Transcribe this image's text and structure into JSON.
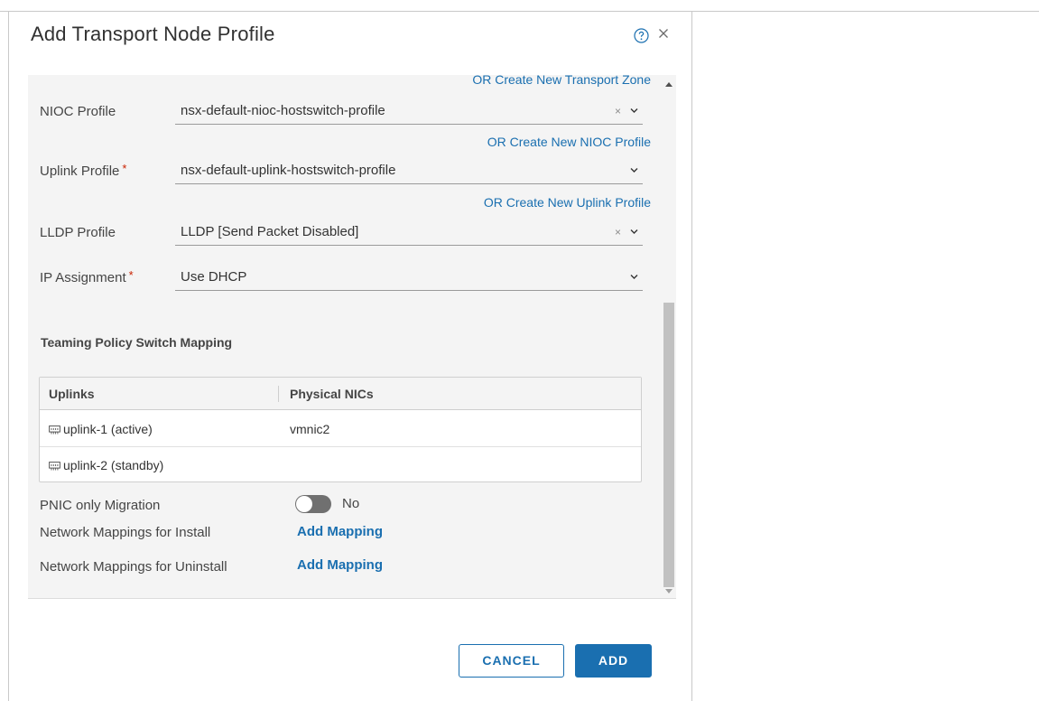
{
  "dialog": {
    "title": "Add Transport Node Profile"
  },
  "links": {
    "create_transport_zone": "OR Create New Transport Zone",
    "create_nioc_profile": "OR Create New NIOC Profile",
    "create_uplink_profile": "OR Create New Uplink Profile"
  },
  "fields": {
    "nioc": {
      "label": "NIOC Profile",
      "value": "nsx-default-nioc-hostswitch-profile"
    },
    "uplink": {
      "label": "Uplink Profile",
      "required_mark": "*",
      "value": "nsx-default-uplink-hostswitch-profile"
    },
    "lldp": {
      "label": "LLDP Profile",
      "value": "LLDP [Send Packet Disabled]"
    },
    "ip": {
      "label": "IP Assignment",
      "required_mark": "*",
      "value": "Use DHCP"
    }
  },
  "clear_glyph": "×",
  "teaming": {
    "title": "Teaming Policy Switch Mapping",
    "columns": [
      "Uplinks",
      "Physical NICs"
    ],
    "rows": [
      {
        "uplink": "uplink-1 (active)",
        "nic": "vmnic2"
      },
      {
        "uplink": "uplink-2 (standby)",
        "nic": ""
      }
    ]
  },
  "pnic": {
    "label": "PNIC only Migration",
    "toggle_text": "No",
    "toggle_on": false
  },
  "mappings": {
    "install_label": "Network Mappings for Install",
    "uninstall_label": "Network Mappings for Uninstall",
    "add_label": "Add Mapping"
  },
  "buttons": {
    "cancel": "CANCEL",
    "add": "ADD"
  },
  "colors": {
    "accent": "#1a6fb0",
    "required": "#c92100",
    "panel": "#f4f4f4"
  },
  "icons": [
    "help-icon",
    "close-icon",
    "chevron-down-icon",
    "network-port-icon"
  ]
}
